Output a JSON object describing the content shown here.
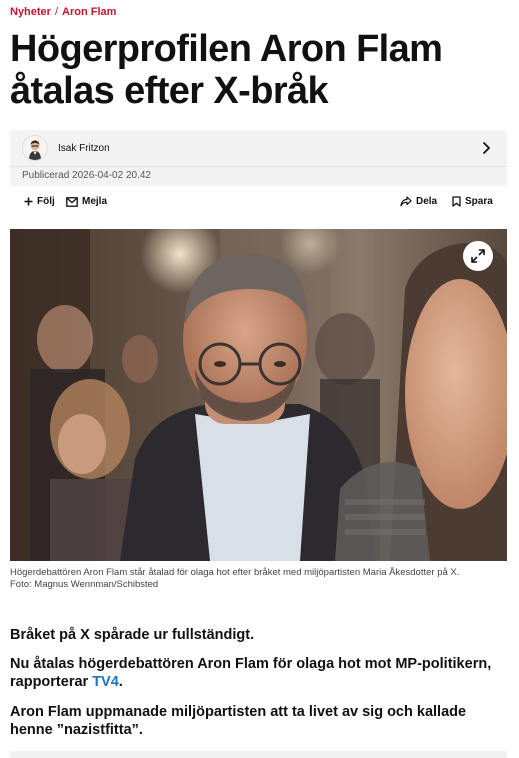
{
  "breadcrumb": {
    "section": "Nyheter",
    "separator": "/",
    "topic": "Aron Flam"
  },
  "headline": "Högerprofilen Aron Flam åtalas efter X-bråk",
  "author": {
    "name": "Isak Fritzon",
    "published": "Publicerad 2026-04-02 20.42"
  },
  "actions": {
    "follow": "Följ",
    "email": "Mejla",
    "share": "Dela",
    "save": "Spara"
  },
  "photo": {
    "caption": "Högerdebattören Aron Flam står åtalad för olaga hot efter bråket med miljöpartisten Maria Åkesdotter på X.",
    "credit": "Foto: Magnus Wennman/Schibsted"
  },
  "lead": {
    "p1": "Bråket på X spårade ur fullständigt.",
    "p2_before": "Nu åtalas högerdebattören Aron Flam för olaga hot mot MP-politikern, rapporterar ",
    "p2_link": "TV4",
    "p2_after": ".",
    "p3": "Aron Flam uppmanade miljöpartisten att ta livet av sig och kallade henne ”nazistfitta”."
  },
  "colors": {
    "brand_red": "#d0112b",
    "link_blue": "#1a73c8",
    "box_gray": "#f3f3f3"
  },
  "icons": [
    "user-avatar",
    "chevron-right-icon",
    "plus-icon",
    "mail-icon",
    "share-icon",
    "bookmark-icon",
    "expand-icon"
  ]
}
